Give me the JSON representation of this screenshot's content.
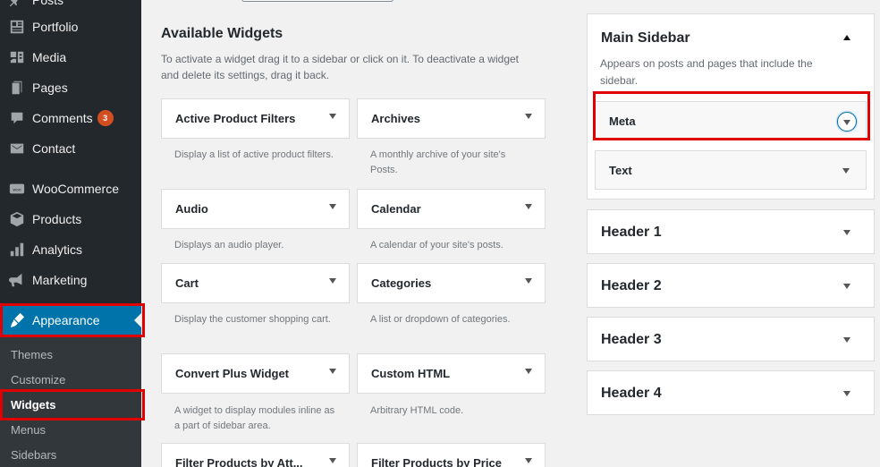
{
  "admin_menu": {
    "items": [
      {
        "label": "Posts",
        "icon": "pin-icon"
      },
      {
        "label": "Portfolio",
        "icon": "portfolio-icon"
      },
      {
        "label": "Media",
        "icon": "media-icon"
      },
      {
        "label": "Pages",
        "icon": "pages-icon"
      },
      {
        "label": "Comments",
        "icon": "comment-icon",
        "badge": "3"
      },
      {
        "label": "Contact",
        "icon": "mail-icon"
      },
      {
        "label": "WooCommerce",
        "icon": "woo-icon"
      },
      {
        "label": "Products",
        "icon": "cube-icon"
      },
      {
        "label": "Analytics",
        "icon": "bar-chart-icon"
      },
      {
        "label": "Marketing",
        "icon": "megaphone-icon"
      },
      {
        "label": "Appearance",
        "icon": "brush-icon",
        "active": true
      }
    ],
    "submenu": [
      "Themes",
      "Customize",
      "Widgets",
      "Menus",
      "Sidebars"
    ],
    "current_sub": "Widgets"
  },
  "available": {
    "title": "Available Widgets",
    "description": "To activate a widget drag it to a sidebar or click on it. To deactivate a widget and delete its settings, drag it back.",
    "widgets": [
      {
        "name": "Active Product Filters",
        "desc": "Display a list of active product filters."
      },
      {
        "name": "Archives",
        "desc": "A monthly archive of your site's Posts."
      },
      {
        "name": "Audio",
        "desc": "Displays an audio player."
      },
      {
        "name": "Calendar",
        "desc": "A calendar of your site's posts."
      },
      {
        "name": "Cart",
        "desc": "Display the customer shopping cart."
      },
      {
        "name": "Categories",
        "desc": "A list or dropdown of categories."
      },
      {
        "name": "Convert Plus Widget",
        "desc": "A widget to display modules inline as a part of sidebar area."
      },
      {
        "name": "Custom HTML",
        "desc": "Arbitrary HTML code."
      },
      {
        "name": "Filter Products by Att...",
        "desc": ""
      },
      {
        "name": "Filter Products by Price",
        "desc": ""
      }
    ]
  },
  "sidebars": {
    "main": {
      "title": "Main Sidebar",
      "description": "Appears on posts and pages that include the sidebar.",
      "widgets": [
        "Meta",
        "Text"
      ]
    },
    "others": [
      "Header 1",
      "Header 2",
      "Header 3",
      "Header 4"
    ]
  },
  "colors": {
    "admin_bg": "#23282d",
    "active": "#0073aa",
    "highlight": "#e00000",
    "badge": "#d54e21"
  }
}
